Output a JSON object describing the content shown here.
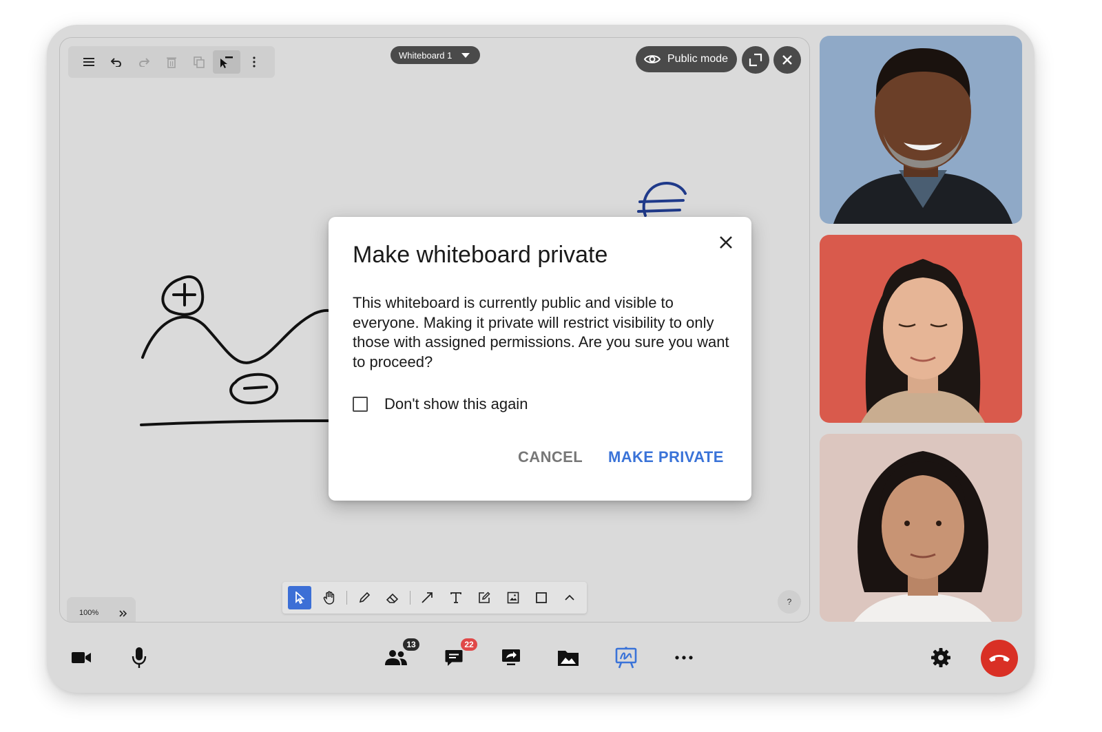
{
  "board": {
    "title": "Whiteboard 1",
    "public_mode_label": "Public mode",
    "zoom": "100%",
    "help_label": "?",
    "top_toolbar": [
      "menu-icon",
      "undo-icon",
      "redo-icon",
      "delete-icon",
      "duplicate-icon",
      "select-mode-icon",
      "more-vert-icon"
    ],
    "drawing_tools": [
      "select",
      "hand",
      "pencil",
      "eraser",
      "arrow",
      "text",
      "sticky-note",
      "image",
      "rectangle",
      "expand-up"
    ]
  },
  "dialog": {
    "title": "Make whiteboard private",
    "body": "This whiteboard is currently public and visible to everyone. Making it private will restrict visibility to only those with assigned permissions. Are you sure you want to proceed?",
    "checkbox_label": "Don't show this again",
    "checkbox_checked": false,
    "cancel_label": "CANCEL",
    "confirm_label": "MAKE PRIVATE"
  },
  "participants": [
    {
      "tile": "participant-1",
      "bg": "#8fa9c7"
    },
    {
      "tile": "participant-2",
      "bg": "#d95a4c"
    },
    {
      "tile": "participant-3",
      "bg": "#dcc6bf"
    }
  ],
  "call_bar": {
    "people_count": "13",
    "chat_count": "22",
    "accent": "#3a73d8",
    "hangup_color": "#d93025",
    "badge_dark": "#2b2b2b",
    "badge_red": "#e04848"
  }
}
